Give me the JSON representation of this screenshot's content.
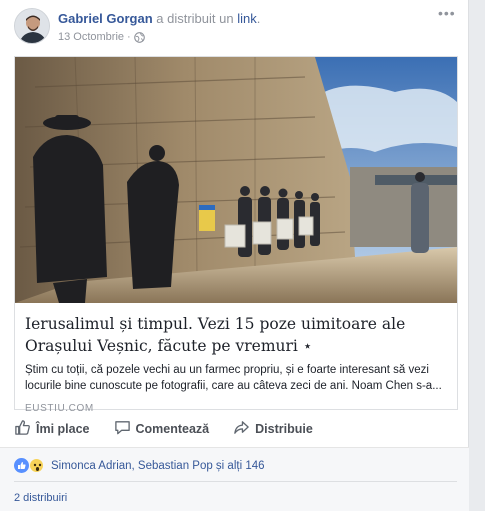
{
  "post": {
    "author": "Gabriel Gorgan",
    "verb": "a distribuit un",
    "link_word": "link",
    "dot": ".",
    "date": "13 Octombrie",
    "separator": "·",
    "more": "•••"
  },
  "attachment": {
    "title": "Ierusalimul și timpul. Vezi 15 poze uimitoare ale Orașului Veșnic, făcute pe vremuri ⋆",
    "description": "Știm cu toții, că pozele vechi au un farmec propriu, și e foarte interesant să vezi locurile bine cunoscute pe fotografii, care au câteva zeci de ani. Noam Chen s-a...",
    "domain": "EUSTIU.COM"
  },
  "actions": {
    "like": "Îmi place",
    "comment": "Comentează",
    "share": "Distribuie"
  },
  "reactions": {
    "names": "Simonca Adrian, Sebastian Pop și alți 146",
    "icons": [
      "like-icon",
      "wow-icon"
    ],
    "like_color": "#5890ff",
    "wow_color": "#f7d358"
  },
  "shares": {
    "label": "2 distribuiri"
  },
  "colors": {
    "link": "#365899",
    "muted": "#90949c",
    "background": "#e9ebee"
  }
}
